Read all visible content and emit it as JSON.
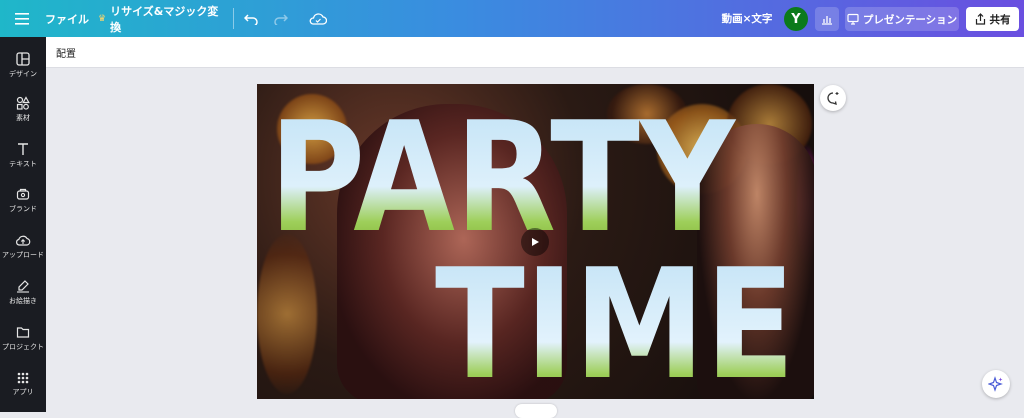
{
  "topbar": {
    "file_label": "ファイル",
    "resize_label": "リサイズ&マジック変換",
    "title": "動画×文字",
    "avatar_letter": "Y",
    "present_label": "プレゼンテーション",
    "share_label": "共有"
  },
  "sidebar": {
    "items": [
      {
        "label": "デザイン",
        "icon": "layout-icon"
      },
      {
        "label": "素材",
        "icon": "shapes-icon"
      },
      {
        "label": "テキスト",
        "icon": "text-icon"
      },
      {
        "label": "ブランド",
        "icon": "brand-icon"
      },
      {
        "label": "アップロード",
        "icon": "upload-icon"
      },
      {
        "label": "お絵描き",
        "icon": "draw-icon"
      },
      {
        "label": "プロジェクト",
        "icon": "folder-icon"
      },
      {
        "label": "アプリ",
        "icon": "apps-icon"
      }
    ]
  },
  "context_bar": {
    "label": "配置"
  },
  "canvas": {
    "line1": "PARTY",
    "line2": "TIME"
  },
  "colors": {
    "gradient_start": "#1fb7c9",
    "gradient_end": "#6a4fe0",
    "sidebar_bg": "#1a1c22",
    "avatar_bg": "#0b7a1b",
    "canvas_bg": "#e9eaef"
  }
}
